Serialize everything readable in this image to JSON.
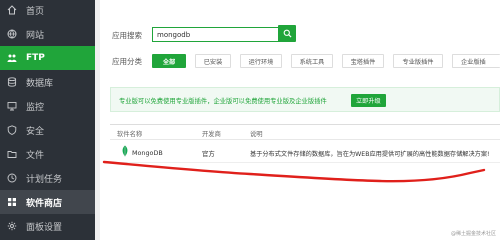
{
  "sidebar": {
    "items": [
      {
        "label": "首页",
        "icon": "home-icon"
      },
      {
        "label": "网站",
        "icon": "globe-icon"
      },
      {
        "label": "FTP",
        "icon": "ftp-icon"
      },
      {
        "label": "数据库",
        "icon": "database-icon"
      },
      {
        "label": "监控",
        "icon": "monitor-icon"
      },
      {
        "label": "安全",
        "icon": "shield-icon"
      },
      {
        "label": "文件",
        "icon": "folder-icon"
      },
      {
        "label": "计划任务",
        "icon": "clock-icon"
      },
      {
        "label": "软件商店",
        "icon": "grid-icon"
      },
      {
        "label": "面板设置",
        "icon": "gear-icon"
      }
    ],
    "active_index": 2,
    "selected_index": 8
  },
  "search": {
    "label": "应用搜索",
    "value": "mongodb"
  },
  "categories": {
    "label": "应用分类",
    "items": [
      "全部",
      "已安装",
      "运行环境",
      "系统工具",
      "宝塔插件",
      "专业版插件",
      "企业版插"
    ]
  },
  "notice": {
    "text": "专业版可以免费使用专业版插件，企业版可以免费使用专业版及企业版插件",
    "button": "立即升级"
  },
  "table": {
    "headers": [
      "软件名称",
      "开发商",
      "说明"
    ],
    "rows": [
      {
        "name": "MongoDB",
        "vendor": "官方",
        "desc": "基于分布式文件存储的数据库，旨在为WEB应用提供可扩展的高性能数据存储解决方案!"
      }
    ]
  },
  "watermark": "@稀土掘金技术社区",
  "colors": {
    "accent": "#20a53a",
    "sidebar_bg": "#2c3138",
    "annotation": "#e0201b"
  }
}
